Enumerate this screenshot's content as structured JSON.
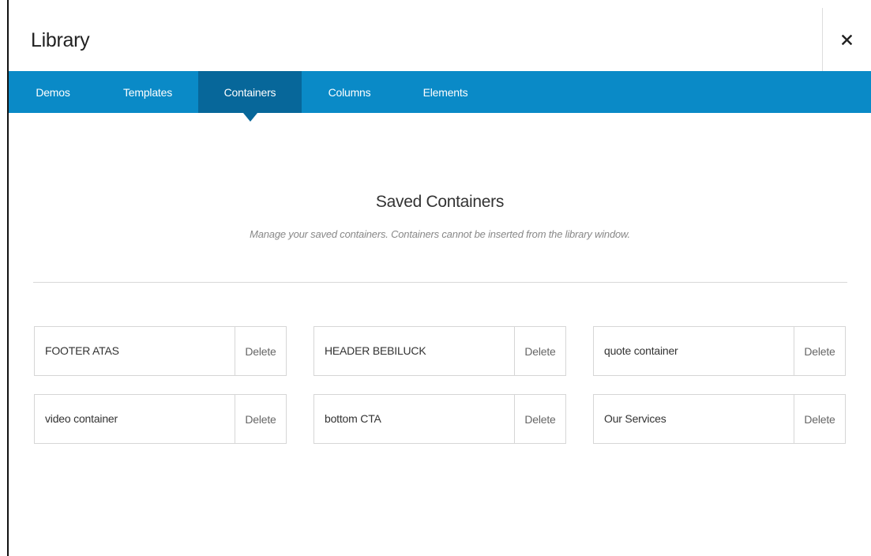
{
  "header": {
    "title": "Library",
    "close_icon": "close-icon"
  },
  "tabs": [
    {
      "label": "Demos",
      "active": false
    },
    {
      "label": "Templates",
      "active": false
    },
    {
      "label": "Containers",
      "active": true
    },
    {
      "label": "Columns",
      "active": false
    },
    {
      "label": "Elements",
      "active": false
    }
  ],
  "section": {
    "title": "Saved Containers",
    "subtitle": "Manage your saved containers. Containers cannot be inserted from the library window."
  },
  "containers": [
    {
      "name": "FOOTER ATAS",
      "delete_label": "Delete"
    },
    {
      "name": "HEADER BEBILUCK",
      "delete_label": "Delete"
    },
    {
      "name": "quote container",
      "delete_label": "Delete"
    },
    {
      "name": "video container",
      "delete_label": "Delete"
    },
    {
      "name": "bottom CTA",
      "delete_label": "Delete"
    },
    {
      "name": "Our Services",
      "delete_label": "Delete"
    }
  ],
  "colors": {
    "tabbar": "#0a8ac7",
    "tab_active": "#07679a"
  }
}
